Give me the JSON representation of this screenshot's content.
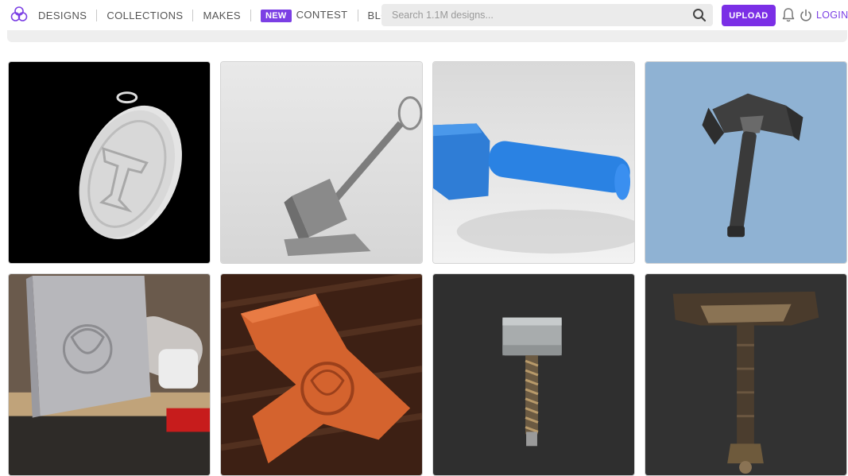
{
  "header": {
    "nav": [
      {
        "label": "DESIGNS"
      },
      {
        "label": "COLLECTIONS"
      },
      {
        "label": "MAKES"
      },
      {
        "label": "CONTEST",
        "badge": "NEW"
      },
      {
        "label": "BLOG"
      }
    ],
    "search_placeholder": "Search 1.1M designs...",
    "upload_label": "UPLOAD",
    "login_label": "LOGIN"
  },
  "colors": {
    "accent": "#7b3fe4",
    "upload_bg": "#7b2fe6"
  },
  "icons": [
    "logo-icon",
    "search-icon",
    "bell-icon",
    "power-icon"
  ],
  "gallery": [
    {
      "subject": "celtic hammer pendant, white render on black"
    },
    {
      "subject": "grey hammer keychain on stand"
    },
    {
      "subject": "blue hammer with handle"
    },
    {
      "subject": "dark winged hammer on blue background"
    },
    {
      "subject": "silver printed hammer with triquetra"
    },
    {
      "subject": "orange celtic hammer pendant on wood"
    },
    {
      "subject": "metal hammer with twisted handle"
    },
    {
      "subject": "bronze ornate hammer"
    }
  ]
}
